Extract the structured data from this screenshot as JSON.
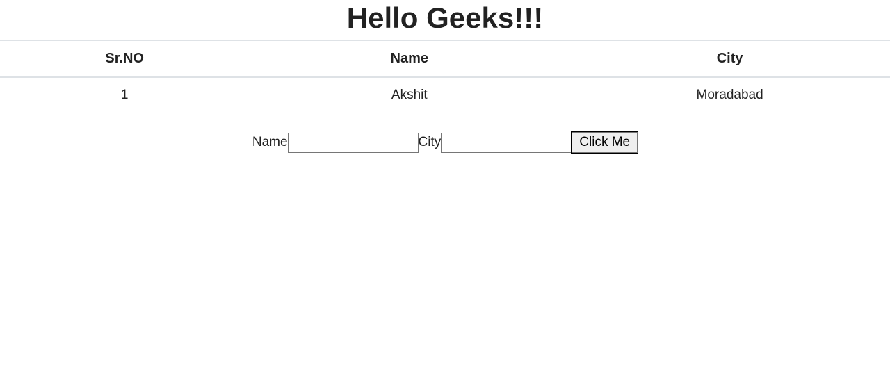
{
  "header": {
    "title": "Hello Geeks!!!"
  },
  "table": {
    "columns": {
      "srno": "Sr.NO",
      "name": "Name",
      "city": "City"
    },
    "rows": [
      {
        "srno": "1",
        "name": "Akshit",
        "city": "Moradabad"
      }
    ]
  },
  "form": {
    "name_label": "Name",
    "name_value": "",
    "city_label": "City",
    "city_value": "",
    "button_label": "Click Me"
  }
}
